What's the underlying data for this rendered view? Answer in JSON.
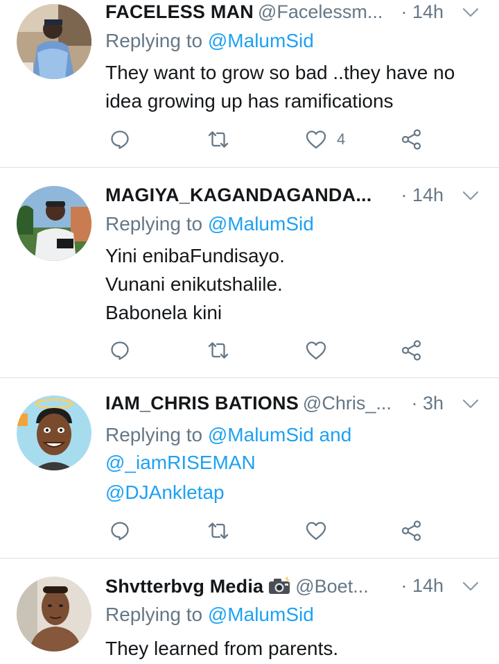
{
  "tweets": [
    {
      "name": "FACELESS MAN",
      "handle": "@Facelessm...",
      "time": "· 14h",
      "replying_prefix": "Replying to ",
      "replying_to": "@MalumSid",
      "body_lines": [
        "They want to grow so bad ..they have no",
        "idea growing up has ramifications"
      ],
      "like_count": "4"
    },
    {
      "name": "MAGIYA_KAGANDAGANDA...",
      "handle": "",
      "time": "· 14h",
      "replying_prefix": "Replying to ",
      "replying_to": "@MalumSid",
      "body_lines": [
        "Yini enibaFundisayo.",
        "Vunani enikutshalile.",
        "Babonela kini"
      ],
      "like_count": ""
    },
    {
      "name": "IAM_CHRIS BATIONS",
      "handle": "@Chris_...",
      "time": "· 3h",
      "replying_prefix": "Replying to ",
      "replying_to": "@MalumSid",
      "replying_and": " and",
      "replying_to_2": "@_iamRISEMAN",
      "body_lines": [
        "@DJAnkletap"
      ],
      "like_count": ""
    },
    {
      "name": "Shvtterbvg Media",
      "handle": "@Boet...",
      "time": "· 14h",
      "replying_prefix": "Replying to ",
      "replying_to": "@MalumSid",
      "body_lines": [
        "They learned from parents."
      ],
      "like_count": ""
    }
  ],
  "icons": {
    "reply": "reply-icon",
    "retweet": "retweet-icon",
    "like": "heart-icon",
    "share": "share-icon",
    "caret": "chevron-down-icon",
    "camera": "camera-with-flash-emoji"
  },
  "colors": {
    "text": "#14171a",
    "secondary": "#657786",
    "link": "#1da1f2",
    "divider": "#dcdfe2"
  }
}
